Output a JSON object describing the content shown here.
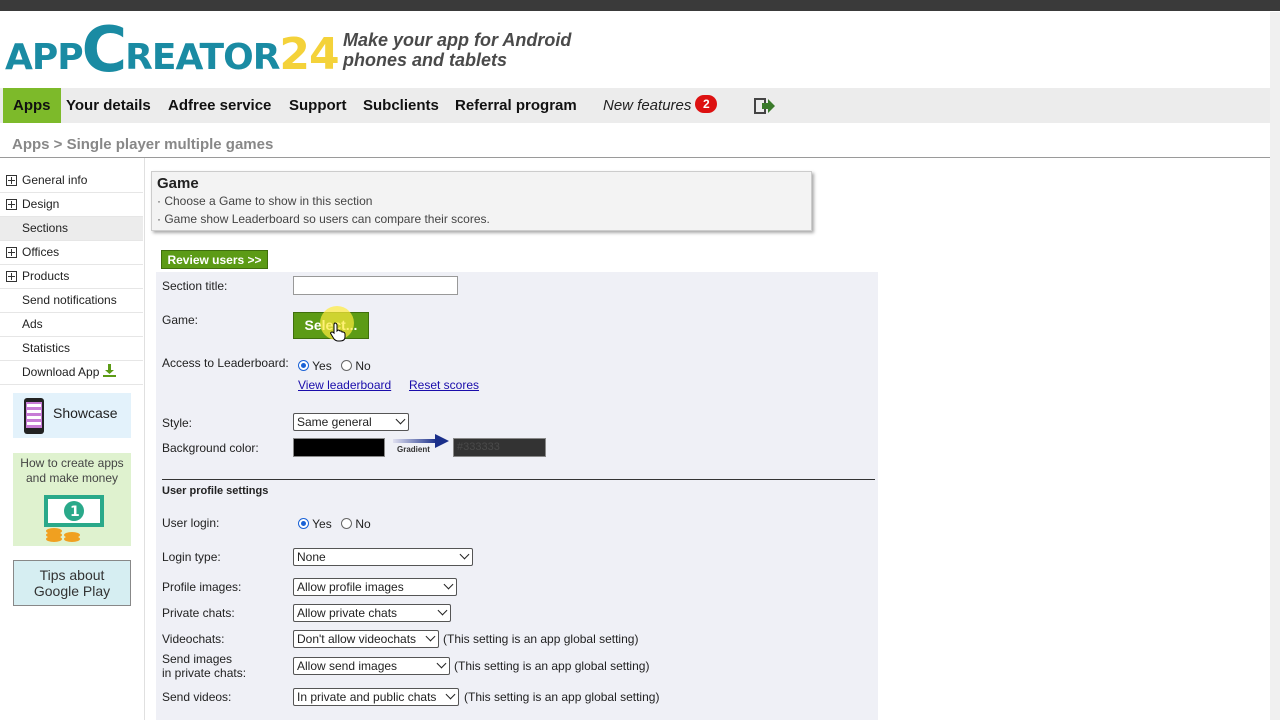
{
  "header": {
    "logo_text_1": "APP",
    "logo_text_2": "C",
    "logo_text_3": "REATOR",
    "logo_text_4": "24",
    "tagline_line1": "Make your app for Android",
    "tagline_line2": "phones and tablets"
  },
  "nav": {
    "items": [
      "Apps",
      "Your details",
      "Adfree service",
      "Support",
      "Subclients",
      "Referral program"
    ],
    "new_features": "New features",
    "new_features_count": "2"
  },
  "breadcrumb": "Apps > Single player multiple games",
  "sidebar": {
    "items": [
      {
        "label": "General info",
        "expandable": true
      },
      {
        "label": "Design",
        "expandable": true
      },
      {
        "label": "Sections",
        "expandable": false
      },
      {
        "label": "Offices",
        "expandable": true
      },
      {
        "label": "Products",
        "expandable": true
      },
      {
        "label": "Send notifications",
        "expandable": false
      },
      {
        "label": "Ads",
        "expandable": false
      },
      {
        "label": "Statistics",
        "expandable": false
      },
      {
        "label": "Download App",
        "expandable": false
      }
    ],
    "showcase_label": "Showcase",
    "money_text_1": "How to create apps",
    "money_text_2": "and make money",
    "tips_line1": "Tips about",
    "tips_line2": "Google Play"
  },
  "info_box": {
    "title": "Game",
    "line1": "· Choose a Game to show in this section",
    "line2": "· Game show Leaderboard so users can compare their scores."
  },
  "review_button": "Review users >>",
  "form": {
    "section_title_label": "Section title:",
    "section_title_value": "",
    "game_label": "Game:",
    "select_button": "Select...",
    "leaderboard_label": "Access to Leaderboard:",
    "yes": "Yes",
    "no": "No",
    "view_leaderboard": "View leaderboard",
    "reset_scores": "Reset scores",
    "style_label": "Style:",
    "style_value": "Same general",
    "bg_label": "Background color:",
    "gradient_label": "Gradient",
    "gradient_color": "#333333",
    "user_profile_heading": "User profile settings",
    "user_login_label": "User login:",
    "login_type_label": "Login type:",
    "login_type_value": "None",
    "profile_images_label": "Profile images:",
    "profile_images_value": "Allow profile images",
    "private_chats_label": "Private chats:",
    "private_chats_value": "Allow private chats",
    "videochats_label": "Videochats:",
    "videochats_value": "Don't allow videochats",
    "send_images_label_1": "Send images",
    "send_images_label_2": "in private chats:",
    "send_images_value": "Allow send images",
    "send_videos_label": "Send videos:",
    "send_videos_value": "In private and public chats",
    "global_note": "(This setting is an app global setting)"
  },
  "colors": {
    "brand_teal": "#1a8ba3",
    "brand_yellow": "#f4d23a",
    "accent_green": "#7dba2a",
    "button_green": "#5c9b16",
    "badge_red": "#dd1111"
  }
}
